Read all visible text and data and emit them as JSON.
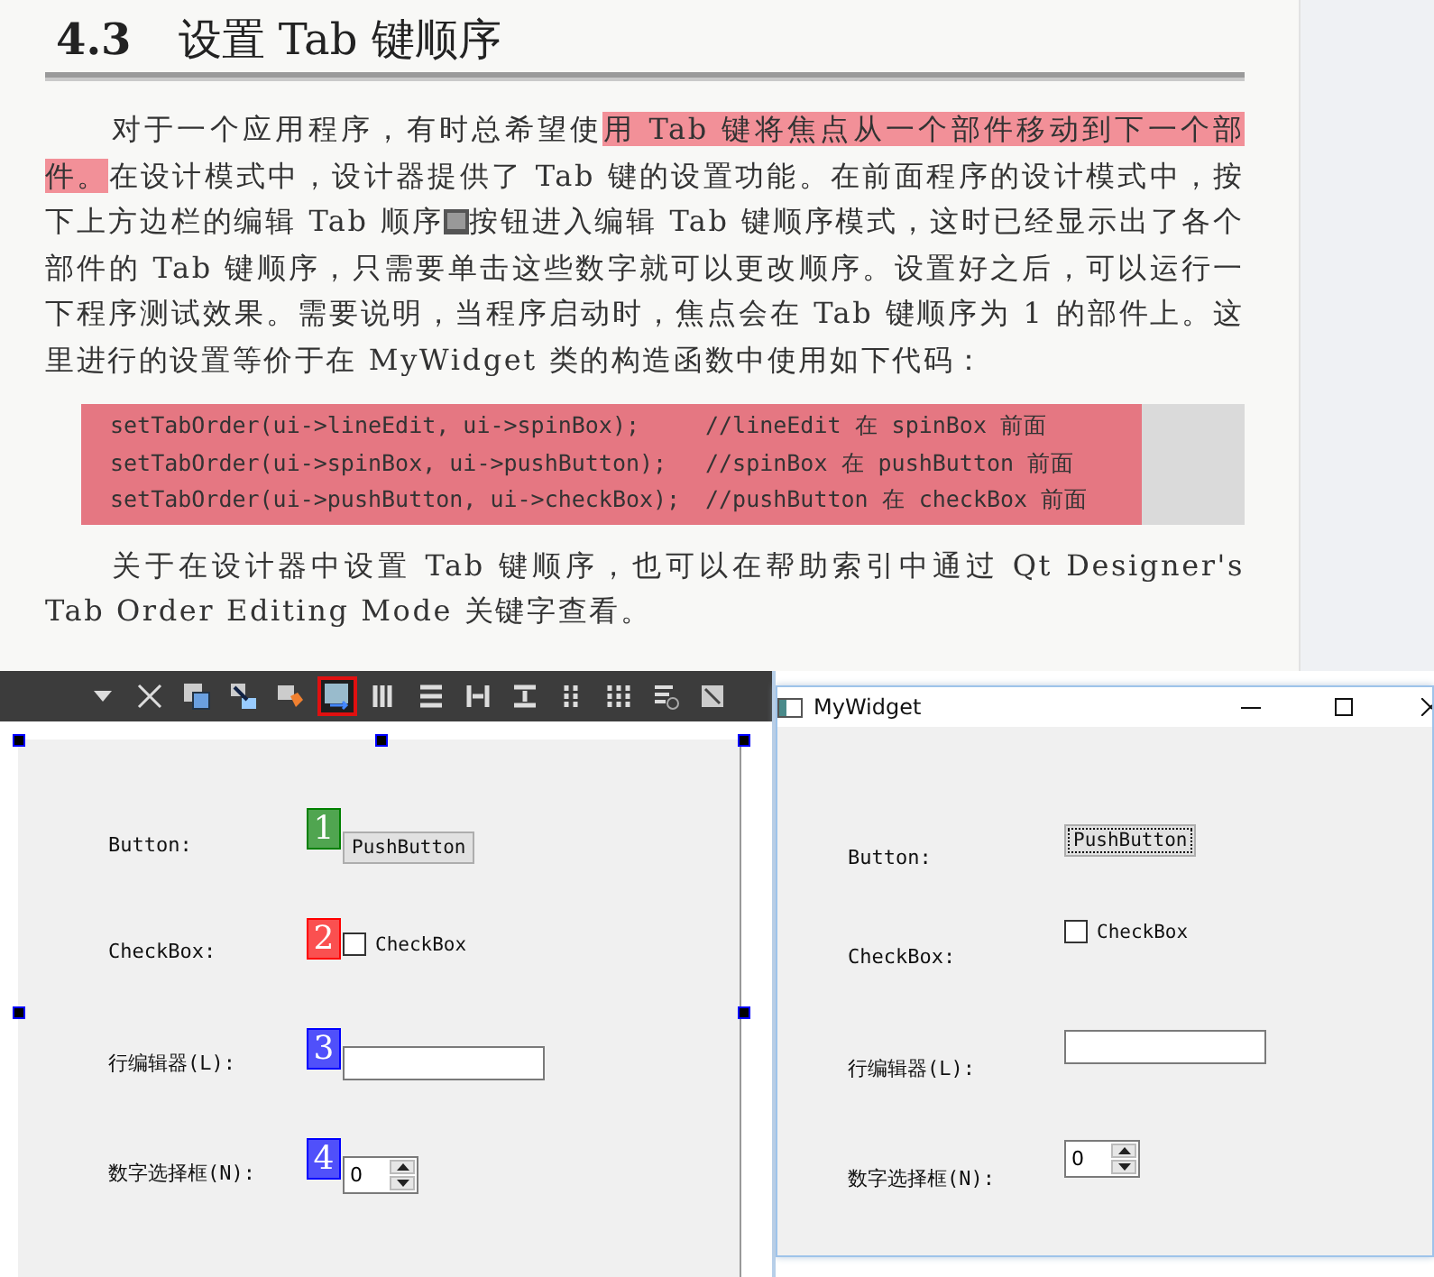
{
  "book_page": {
    "section_number": "4.3",
    "section_title": "设置 Tab 键顺序",
    "paragraph_1": [
      {
        "kind": "text",
        "text": "对于一个应用程序，有时总希望使",
        "highlighted": false
      },
      {
        "kind": "text",
        "text": "用 Tab 键将焦点从一个部件移动到下一个部件。",
        "highlighted": true
      },
      {
        "kind": "text",
        "text": "在设计模式中，设计器提供了 Tab 键的设置功能。在前面程序的设计模式中，按下上方边栏的编辑 Tab 顺序",
        "highlighted": false
      },
      {
        "kind": "icon"
      },
      {
        "kind": "text",
        "text": "按钮进入编辑 Tab 键顺序模式，这时已经显示出了各个部件的 Tab 键顺序，只需要单击这些数字就可以更改顺序。设置好之后，可以运行一下程序测试效果。需要说明，当程序启动时，焦点会在 Tab 键顺序为 1 的部件上。这里进行的设置等价于在 MyWidget 类的构造函数中使用如下代码：",
        "highlighted": false
      }
    ],
    "code_highlighted": true,
    "code_lines": [
      {
        "code": "setTabOrder(ui->lineEdit, ui->spinBox);",
        "comment": "//lineEdit 在 spinBox 前面"
      },
      {
        "code": "setTabOrder(ui->spinBox, ui->pushButton);",
        "comment": "//spinBox 在 pushButton 前面"
      },
      {
        "code": "setTabOrder(ui->pushButton, ui->checkBox);",
        "comment": "//pushButton 在 checkBox 前面"
      }
    ],
    "paragraph_2": "关于在设计器中设置 Tab 键顺序，也可以在帮助索引中通过 Qt Designer's Tab Order Editing Mode 关键字查看。"
  },
  "designer": {
    "toolbar": [
      {
        "kind": "dropdown",
        "selected": false
      },
      {
        "kind": "close",
        "selected": false
      },
      {
        "kind": "widget-edit",
        "selected": false
      },
      {
        "kind": "signal-edit",
        "selected": false
      },
      {
        "kind": "buddy-edit",
        "selected": false
      },
      {
        "kind": "tab-order",
        "selected": true
      },
      {
        "kind": "h-layout",
        "selected": false
      },
      {
        "kind": "v-layout",
        "selected": false
      },
      {
        "kind": "h-split",
        "selected": false
      },
      {
        "kind": "v-split",
        "selected": false
      },
      {
        "kind": "form",
        "selected": false
      },
      {
        "kind": "grid",
        "selected": false
      },
      {
        "kind": "break",
        "selected": false
      },
      {
        "kind": "adjust",
        "selected": false
      }
    ],
    "rows": [
      {
        "label": "Button:",
        "kind": "button",
        "text": "PushButton",
        "order": {
          "number": "1",
          "color": "#008000"
        }
      },
      {
        "label": "CheckBox:",
        "kind": "checkbox",
        "text": "CheckBox",
        "checked": false,
        "order": {
          "number": "2",
          "color": "#ff0000"
        }
      },
      {
        "label": "行编辑器(L):",
        "kind": "line-edit",
        "order": {
          "number": "3",
          "color": "#0000ff"
        }
      },
      {
        "label": "数字选择框(N):",
        "kind": "spin-box",
        "text": "0",
        "order": {
          "number": "4",
          "color": "#0000ff"
        }
      }
    ]
  },
  "preview_window": {
    "title": "MyWidget",
    "rows": [
      {
        "label": "Button:",
        "kind": "button",
        "text": "PushButton",
        "focused": true
      },
      {
        "label": "CheckBox:",
        "kind": "checkbox",
        "text": "CheckBox",
        "checked": false
      },
      {
        "label": "行编辑器(L):",
        "kind": "line-edit"
      },
      {
        "label": "数字选择框(N):",
        "kind": "spin-box",
        "text": "0"
      }
    ]
  }
}
